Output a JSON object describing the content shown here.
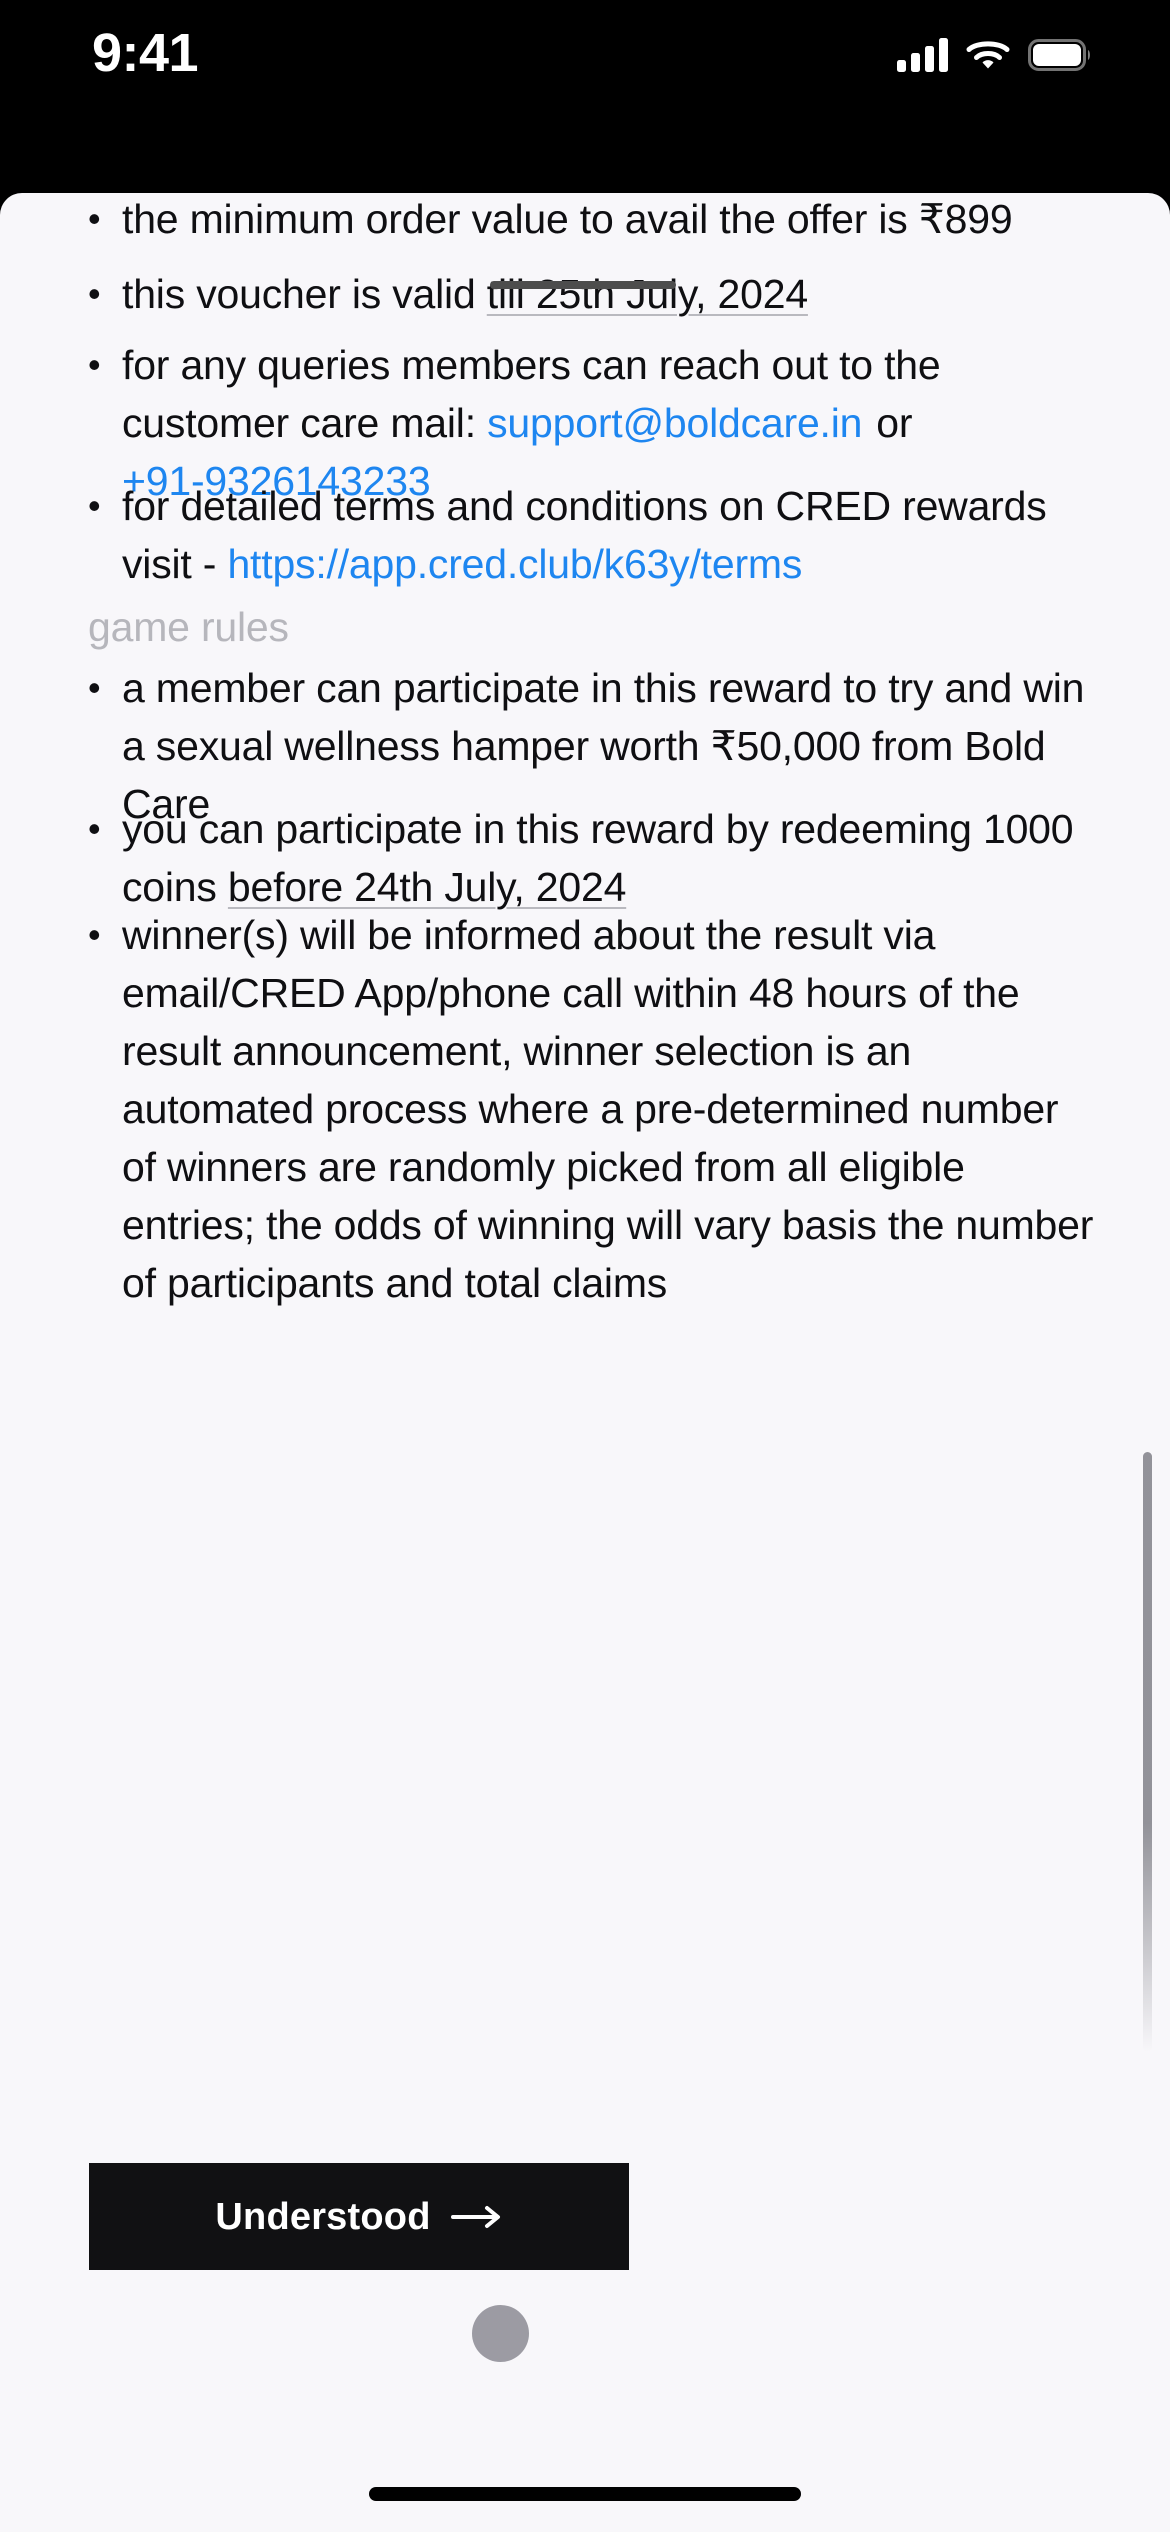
{
  "status_bar": {
    "time": "9:41",
    "cellular_icon": "cellular-bars-icon",
    "wifi_icon": "wifi-icon",
    "battery_icon": "battery-full-icon"
  },
  "sheet": {
    "grabber": "drag-handle",
    "background_color": "#F8F7FA",
    "link_color": "#1E86F0",
    "section_label_color": "#B6B6BC",
    "text_color": "#0F0F12"
  },
  "terms": {
    "bullet_1": "the minimum order value to avail the offer is ₹899",
    "bullet_2_prefix": "this voucher is valid ",
    "bullet_2_date": "till 25th July, 2024",
    "bullet_3_part1": "for any queries members can reach out to the customer care mail: ",
    "bullet_3_email": "support@boldcare.in",
    "bullet_3_part2": "or",
    "bullet_3_phone": "+91-9326143233",
    "bullet_4_prefix": "for detailed terms and conditions on CRED rewards visit - ",
    "bullet_4_url": "https://app.cred.club/k63y/terms"
  },
  "game_rules": {
    "heading": "game rules",
    "rule_1": "a member can participate in this reward to try and win a sexual wellness hamper worth ₹50,000 from Bold Care",
    "rule_2_prefix": "you can participate in this reward by redeeming 1000 coins ",
    "rule_2_date": "before 24th July, 2024",
    "rule_3": "winner(s) will be informed about the result via email/CRED App/phone call within 48 hours of the result announcement, winner selection is an automated process where a pre-determined number of winners are randomly picked from all eligible entries; the odds of winning will vary basis the number of participants and total claims"
  },
  "cta": {
    "label": "Understood",
    "arrow_icon": "arrow-right-icon"
  },
  "system": {
    "home_indicator": "home-indicator",
    "touch_indicator": "touch-point-indicator",
    "scroll_indicator": "vertical-scroll-indicator"
  }
}
